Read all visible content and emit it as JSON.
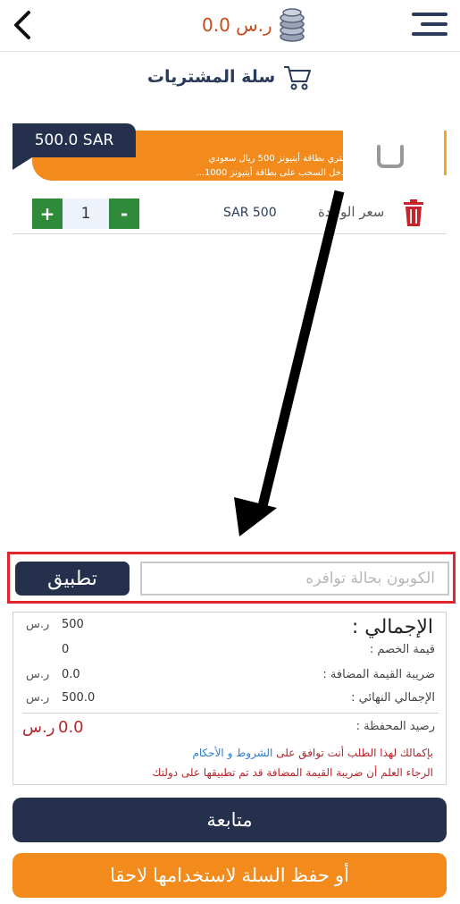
{
  "header": {
    "balance": "0.0 ر.س",
    "back_icon": "chevron-left-icon",
    "menu_icon": "hamburger-menu-icon",
    "coins_icon": "coins-icon"
  },
  "cart": {
    "title": "سلة المشتريات",
    "icon": "shopping-cart-icon"
  },
  "product": {
    "price_tag": "500.0 SAR",
    "banner_line1": "اشتري بطاقة أيتيونز 500 ريال سعودي",
    "banner_line2": "وادخل السحب على بطاقة أيتيونز 1000...",
    "unit_price": "SAR  500",
    "unit_price_label": "سعر الوحدة",
    "quantity": "1",
    "plus_label": "+",
    "minus_label": "-",
    "colors": {
      "banner": "#f28a1c",
      "tag": "#24304c",
      "qty": "#2f8a3a"
    }
  },
  "coupon": {
    "placeholder": "الكوبون بحالة توافره",
    "apply_label": "تطبيق"
  },
  "summary": {
    "title": "الإجمالي :",
    "rows": [
      {
        "label": "قيمة الخصم :",
        "value": "500",
        "currency": "ر.س"
      },
      {
        "label": "ضريبة القيمة المضافة :",
        "value": "0",
        "currency": "ر.س"
      },
      {
        "label": "الإجمالي النهائي :",
        "value": "0.0",
        "currency": "ر.س"
      },
      {
        "label": "",
        "value": "500.0",
        "currency": "ر.س"
      }
    ],
    "wallet_label": "رصيد المحفظة :",
    "wallet_value": "0.0",
    "wallet_currency": "ر.س",
    "terms_prefix": "بإكمالك لهذا الطلب أنت توافق على",
    "terms_link": "الشروط و الأحكام",
    "vat_note": "الرجاء العلم أن ضريبة القيمة المضافة قد تم تطبيقها على دولتك"
  },
  "actions": {
    "continue_label": "متابعة",
    "save_label": "أو حفظ السلة لاستخدامها لاحقا"
  }
}
